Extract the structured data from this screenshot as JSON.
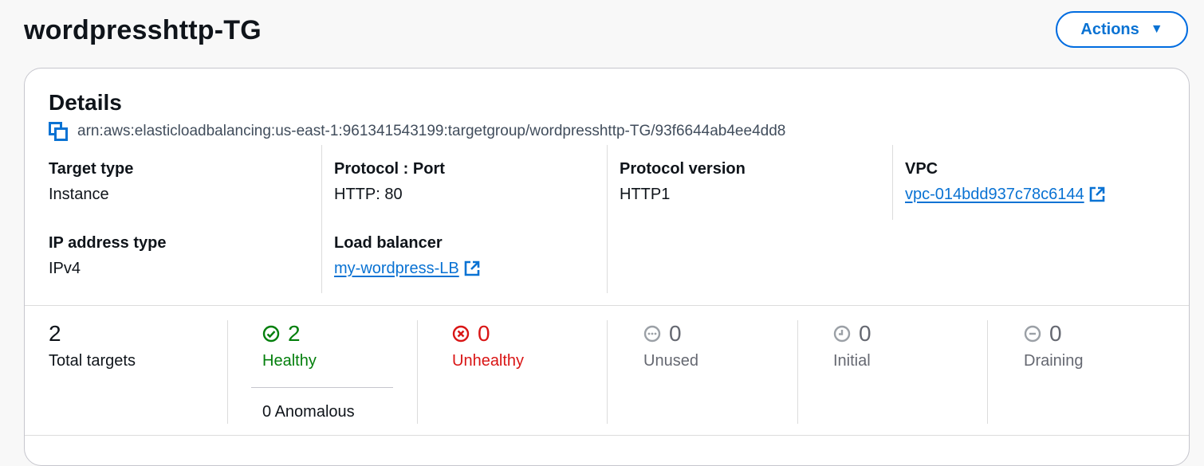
{
  "header": {
    "title": "wordpresshttp-TG",
    "actions_label": "Actions"
  },
  "details": {
    "title": "Details",
    "arn": "arn:aws:elasticloadbalancing:us-east-1:961341543199:targetgroup/wordpresshttp-TG/93f6644ab4ee4dd8",
    "fields": {
      "target_type": {
        "label": "Target type",
        "value": "Instance"
      },
      "protocol_port": {
        "label": "Protocol : Port",
        "value": "HTTP: 80"
      },
      "protocol_version": {
        "label": "Protocol version",
        "value": "HTTP1"
      },
      "vpc": {
        "label": "VPC",
        "value": "vpc-014bdd937c78c6144"
      },
      "ip_address_type": {
        "label": "IP address type",
        "value": "IPv4"
      },
      "load_balancer": {
        "label": "Load balancer",
        "value": "my-wordpress-LB"
      }
    }
  },
  "targets": {
    "total": {
      "count": "2",
      "label": "Total targets"
    },
    "healthy": {
      "count": "2",
      "label": "Healthy",
      "sub": "0 Anomalous",
      "icon": "check-circle-icon",
      "color": "#037f0c"
    },
    "unhealthy": {
      "count": "0",
      "label": "Unhealthy",
      "icon": "x-circle-icon",
      "color": "#d91515"
    },
    "unused": {
      "count": "0",
      "label": "Unused",
      "icon": "ellipsis-circle-icon",
      "color": "#656871"
    },
    "initial": {
      "count": "0",
      "label": "Initial",
      "icon": "clock-icon",
      "color": "#656871"
    },
    "draining": {
      "count": "0",
      "label": "Draining",
      "icon": "minus-circle-icon",
      "color": "#656871"
    }
  }
}
